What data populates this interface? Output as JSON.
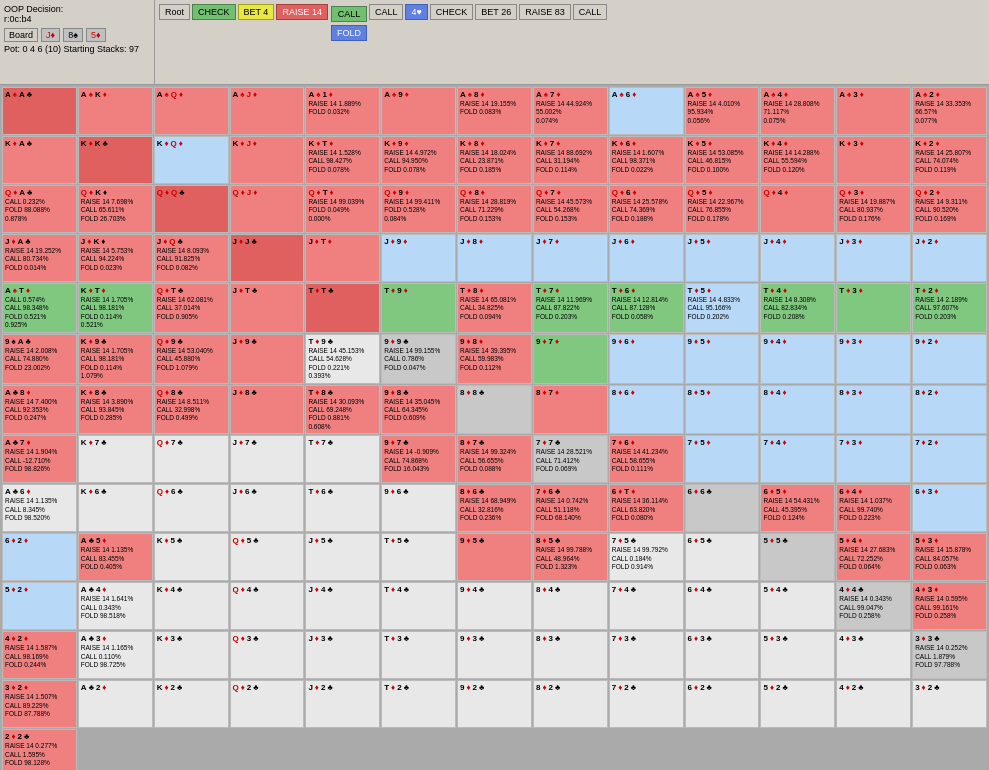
{
  "header": {
    "oop_decision_label": "OOP Decision:",
    "oop_hand": "r:0c:b4",
    "board_label": "Board",
    "board_cards": [
      "J♦",
      "8♠",
      "5♦"
    ],
    "pot_info": "Pot: 0 4 6 (10) Starting Stacks: 97"
  },
  "nav": {
    "buttons": [
      {
        "label": "Root",
        "state": "normal"
      },
      {
        "label": "CHECK",
        "state": "active-green"
      },
      {
        "label": "BET 4",
        "state": "active-yellow"
      },
      {
        "label": "RAISE 14",
        "state": "active-red"
      },
      {
        "label": "CALL",
        "state": "normal"
      },
      {
        "label": "4♥",
        "state": "active-blue"
      },
      {
        "label": "CHECK",
        "state": "normal"
      },
      {
        "label": "BET 26",
        "state": "normal"
      },
      {
        "label": "RAISE 83",
        "state": "normal"
      },
      {
        "label": "CALL",
        "state": "normal"
      }
    ],
    "sub_call": "CALL",
    "sub_fold": "FOLD"
  },
  "bottom": {
    "raise_label": "RAISE 14",
    "call_label": "CALL",
    "fold_label": "FOLD"
  }
}
